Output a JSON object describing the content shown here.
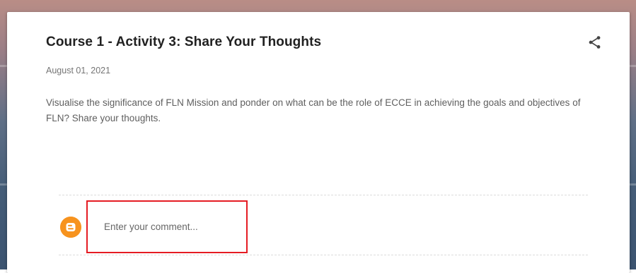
{
  "post": {
    "title": "Course 1 - Activity 3: Share Your Thoughts",
    "date": "August 01, 2021",
    "body": "Visualise the significance of FLN Mission and ponder on what can be the role of ECCE in achieving the goals and objectives of FLN? Share your thoughts."
  },
  "comments": {
    "placeholder": "Enter your comment..."
  },
  "icons": {
    "share": "share-icon",
    "avatar": "blogger-icon"
  },
  "colors": {
    "highlight_border": "#e51c23",
    "avatar_bg": "#f7931e"
  }
}
